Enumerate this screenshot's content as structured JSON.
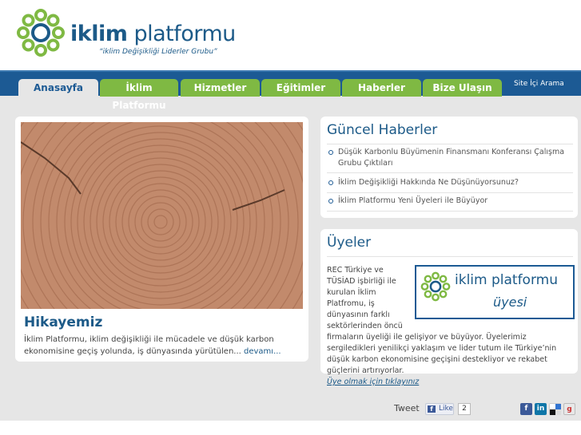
{
  "header": {
    "logo_bold": "iklim",
    "logo_light": "platformu",
    "tagline": "“iklim Değişikliği Liderler Grubu”"
  },
  "nav": {
    "tabs": [
      "Anasayfa",
      "İklim Platformu",
      "Hizmetler",
      "Eğitimler",
      "Haberler",
      "Bize Ulaşın"
    ],
    "search_label": "Site İçi Arama"
  },
  "story": {
    "title": "Hikayemiz",
    "text": "İklim Platformu, iklim değişikliği ile mücadele ve düşük karbon ekonomisine geçiş yolunda, iş dünyasında yürütülen...",
    "more_link": "devamı..."
  },
  "news": {
    "title": "Güncel Haberler",
    "items": [
      "Düşük Karbonlu Büyümenin Finansmanı Konferansı Çalışma Grubu Çıktıları",
      "İklim Değişikliği Hakkında Ne Düşünüyorsunuz?",
      "İklim Platformu Yeni Üyeleri ile Büyüyor"
    ]
  },
  "members": {
    "title": "Üyeler",
    "text": "REC Türkiye ve TÜSİAD işbirliği ile kurulan İklim Platfromu, iş dünyasının farklı sektörlerinden öncü firmaların üyeliği ile gelişiyor ve büyüyor. Üyelerimiz sergiledikleri yenilikçi yaklaşım ve lider tutum ile Türkiye’nin düşük karbon ekonomisine geçişini destekliyor ve rekabet güçlerini artırıyorlar.",
    "join_link": "Üye olmak için tıklayınız",
    "badge_line1": "iklim platformu",
    "badge_line2": "üyesi"
  },
  "footer": {
    "tweet": "Tweet",
    "like": "Like",
    "like_count": "2"
  },
  "colors": {
    "brand_blue": "#1c5a94",
    "brand_green": "#7fb943"
  },
  "icons": [
    "logo-mark-icon",
    "facebook-icon",
    "linkedin-icon",
    "delicious-icon",
    "google-icon"
  ]
}
